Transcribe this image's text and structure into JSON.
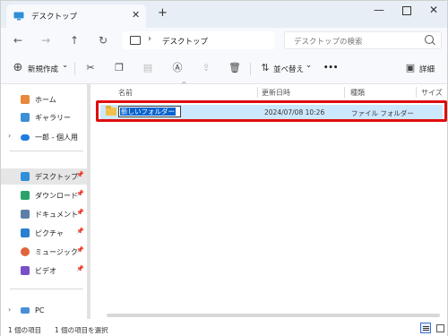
{
  "tab": {
    "title": "デスクトップ",
    "close": "✕",
    "new_tab": "+"
  },
  "window_controls": {
    "minimize": "—",
    "close": "✕"
  },
  "nav": {
    "back": "←",
    "forward": "→",
    "up": "↑",
    "refresh": "↻",
    "breadcrumb_sep": "›",
    "location": "デスクトップ"
  },
  "search": {
    "placeholder": "デスクトップの検索"
  },
  "commands": {
    "new_label": "新規作成",
    "new_caret": "⌄",
    "sort_label": "並べ替え",
    "sort_caret": "⌄",
    "more": "•••",
    "details_label": "詳細"
  },
  "sidebar": {
    "items": [
      {
        "label": "ホーム"
      },
      {
        "label": "ギャラリー"
      },
      {
        "label": "一郎 - 個人用",
        "expander": "›"
      },
      {
        "label": "デスクトップ",
        "pin": "📌"
      },
      {
        "label": "ダウンロード",
        "pin": "📌"
      },
      {
        "label": "ドキュメント",
        "pin": "📌"
      },
      {
        "label": "ピクチャ",
        "pin": "📌"
      },
      {
        "label": "ミュージック",
        "pin": "📌"
      },
      {
        "label": "ビデオ",
        "pin": "📌"
      },
      {
        "label": "PC",
        "expander": "›"
      }
    ]
  },
  "columns": {
    "name": "名前",
    "modified": "更新日時",
    "type": "種類",
    "size": "サイズ",
    "sort_caret": "^"
  },
  "rows": [
    {
      "name": "新しいフォルダー",
      "modified": "2024/07/08 10:26",
      "type": "ファイル フォルダー",
      "size": ""
    }
  ],
  "status": {
    "count": "1 個の項目",
    "selected": "1 個の項目を選択"
  },
  "colors": {
    "selection": "#cce8ff",
    "highlight": "#e00d0d",
    "rename_selection": "#0a64d0",
    "folder": "#f2c14b"
  }
}
